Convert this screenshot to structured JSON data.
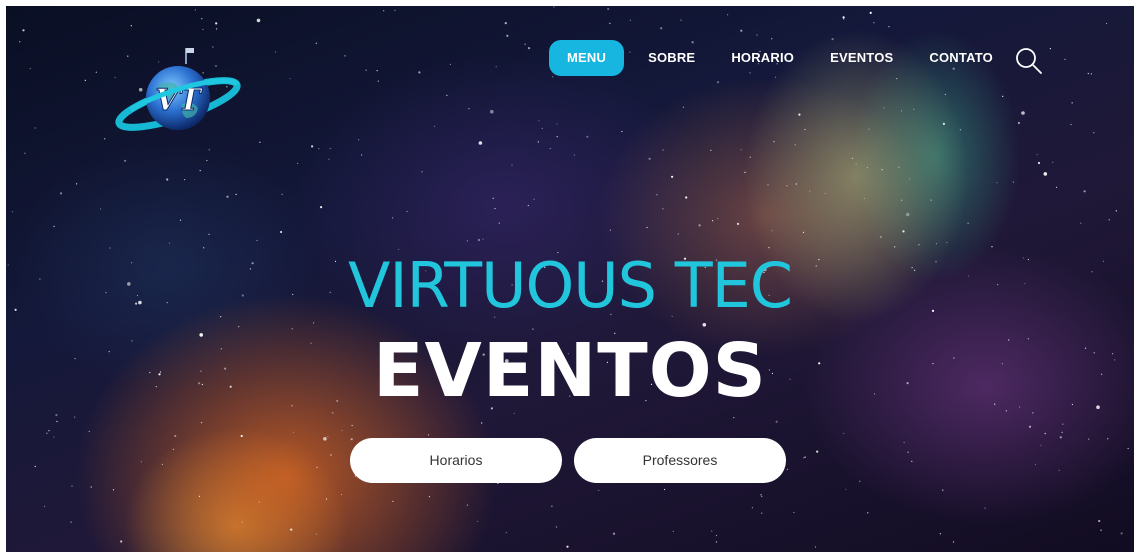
{
  "nav": {
    "items": [
      {
        "label": "MENU",
        "active": true
      },
      {
        "label": "SOBRE",
        "active": false
      },
      {
        "label": "HORARIO",
        "active": false
      },
      {
        "label": "EVENTOS",
        "active": false
      },
      {
        "label": "CONTATO",
        "active": false
      }
    ],
    "search_icon": "search-icon",
    "active_color": "#16b6e0"
  },
  "logo": {
    "text": "VT",
    "icon": "planet-logo"
  },
  "hero": {
    "title": "VIRTUOUS TEC",
    "subtitle": "EVENTOS",
    "title_color": "#22c6dc",
    "subtitle_color": "#ffffff"
  },
  "buttons": {
    "horarios_label": "Horarios",
    "professores_label": "Professores"
  }
}
